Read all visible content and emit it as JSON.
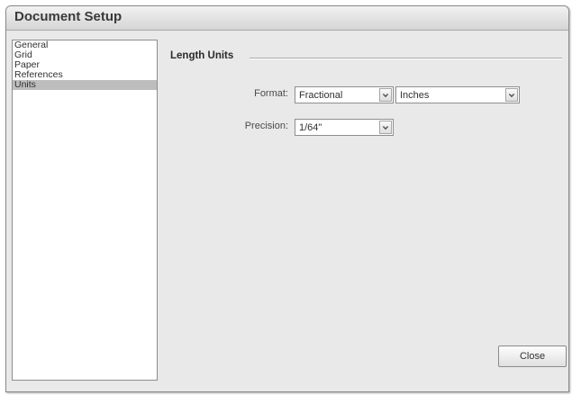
{
  "window": {
    "title": "Document Setup"
  },
  "sidebar": {
    "items": [
      {
        "label": "General"
      },
      {
        "label": "Grid"
      },
      {
        "label": "Paper"
      },
      {
        "label": "References"
      },
      {
        "label": "Units",
        "selected": true
      }
    ]
  },
  "section": {
    "title": "Length Units"
  },
  "format": {
    "label": "Format:",
    "type_value": "Fractional",
    "unit_value": "Inches"
  },
  "precision": {
    "label": "Precision:",
    "value": "1/64\""
  },
  "buttons": {
    "close_label": "Close"
  },
  "icons": {
    "dropdown": "chevron-down-icon"
  },
  "colors": {
    "selected_item": "#bdbdbd",
    "panel_bg": "#e9e9e9"
  }
}
